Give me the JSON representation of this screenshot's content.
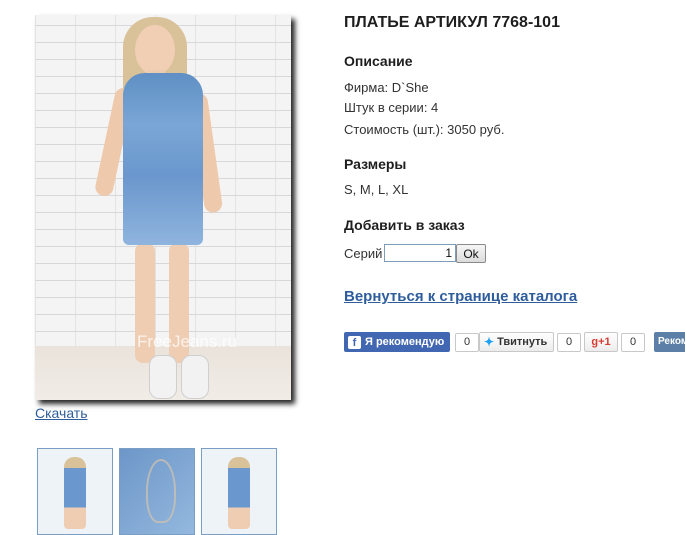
{
  "product": {
    "title": "ПЛАТЬЕ АРТИКУЛ 7768-101",
    "watermark": "FreeJeans.ru",
    "download_label": "Скачать"
  },
  "description": {
    "heading": "Описание",
    "firm": "Фирма: D`She",
    "count": "Штук в серии: 4",
    "price": "Стоимость (шт.): 3050 руб."
  },
  "sizes": {
    "heading": "Размеры",
    "values": "S, M, L, XL"
  },
  "order": {
    "heading": "Добавить в заказ",
    "series_label": "Серий",
    "quantity": "1",
    "ok_label": "Ok"
  },
  "back_link": "Вернуться к странице каталога",
  "social": {
    "facebook_label": "Я рекомендую",
    "facebook_count": "0",
    "twitter_label": "Твитнуть",
    "twitter_count": "0",
    "gplus_label": "+1",
    "gplus_count": "0",
    "vk_label": "Реком"
  },
  "colors": {
    "link": "#2f5d9c",
    "facebook": "#4267b2",
    "vk": "#5b7fa6"
  }
}
